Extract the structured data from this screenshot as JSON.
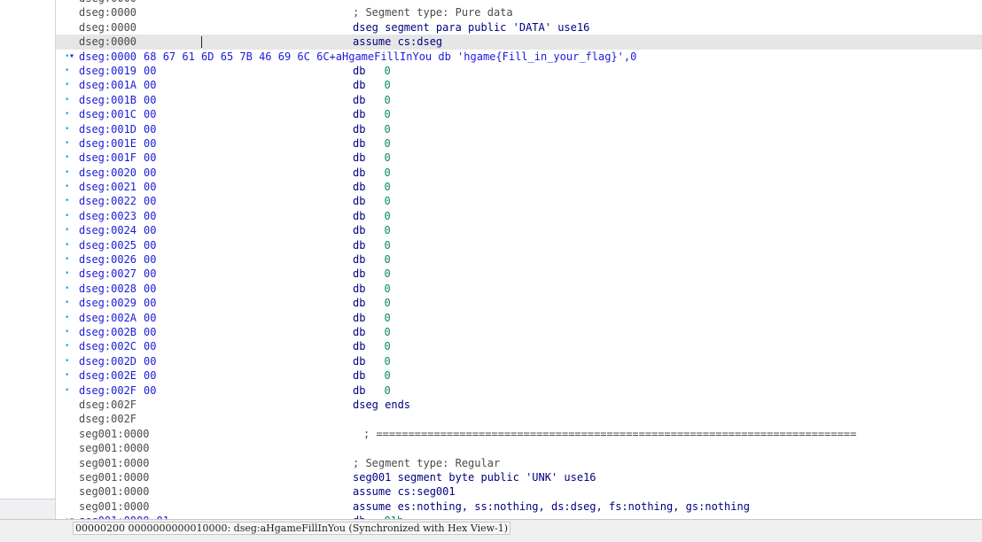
{
  "status_text": "00000200 0000000000010000: dseg:aHgameFillInYou (Synchronized with Hex View-1)",
  "colors": {
    "accent": "#1b1bd8",
    "comment": "#4a4a4a",
    "number": "#0b8a5d",
    "selected_bg": "#e6e6e6"
  },
  "listing": [
    {
      "addr": "dseg:0000",
      "bytes": "",
      "text": "",
      "kind": "partial"
    },
    {
      "addr": "dseg:0000",
      "bytes": "",
      "text": "; Segment type: Pure data",
      "kind": "comment"
    },
    {
      "addr": "dseg:0000",
      "bytes": "",
      "text": "dseg segment para public 'DATA' use16",
      "kind": "directive"
    },
    {
      "addr": "dseg:0000",
      "bytes": "",
      "text": "assume cs:dseg",
      "kind": "directive",
      "selected": true
    },
    {
      "addr": "dseg:0000",
      "bytes": "68 67 61 6D 65 7B 46 69 6C 6C+",
      "text": "aHgameFillInYou db 'hgame{Fill_in_your_flag}',0",
      "kind": "string",
      "dot": true
    },
    {
      "addr": "dseg:0019",
      "bytes": "00",
      "mnem": "db",
      "val": "0",
      "kind": "db",
      "dot": true
    },
    {
      "addr": "dseg:001A",
      "bytes": "00",
      "mnem": "db",
      "val": "0",
      "kind": "db",
      "dot": true
    },
    {
      "addr": "dseg:001B",
      "bytes": "00",
      "mnem": "db",
      "val": "0",
      "kind": "db",
      "dot": true
    },
    {
      "addr": "dseg:001C",
      "bytes": "00",
      "mnem": "db",
      "val": "0",
      "kind": "db",
      "dot": true
    },
    {
      "addr": "dseg:001D",
      "bytes": "00",
      "mnem": "db",
      "val": "0",
      "kind": "db",
      "dot": true
    },
    {
      "addr": "dseg:001E",
      "bytes": "00",
      "mnem": "db",
      "val": "0",
      "kind": "db",
      "dot": true
    },
    {
      "addr": "dseg:001F",
      "bytes": "00",
      "mnem": "db",
      "val": "0",
      "kind": "db",
      "dot": true
    },
    {
      "addr": "dseg:0020",
      "bytes": "00",
      "mnem": "db",
      "val": "0",
      "kind": "db",
      "dot": true
    },
    {
      "addr": "dseg:0021",
      "bytes": "00",
      "mnem": "db",
      "val": "0",
      "kind": "db",
      "dot": true
    },
    {
      "addr": "dseg:0022",
      "bytes": "00",
      "mnem": "db",
      "val": "0",
      "kind": "db",
      "dot": true
    },
    {
      "addr": "dseg:0023",
      "bytes": "00",
      "mnem": "db",
      "val": "0",
      "kind": "db",
      "dot": true
    },
    {
      "addr": "dseg:0024",
      "bytes": "00",
      "mnem": "db",
      "val": "0",
      "kind": "db",
      "dot": true
    },
    {
      "addr": "dseg:0025",
      "bytes": "00",
      "mnem": "db",
      "val": "0",
      "kind": "db",
      "dot": true
    },
    {
      "addr": "dseg:0026",
      "bytes": "00",
      "mnem": "db",
      "val": "0",
      "kind": "db",
      "dot": true
    },
    {
      "addr": "dseg:0027",
      "bytes": "00",
      "mnem": "db",
      "val": "0",
      "kind": "db",
      "dot": true
    },
    {
      "addr": "dseg:0028",
      "bytes": "00",
      "mnem": "db",
      "val": "0",
      "kind": "db",
      "dot": true
    },
    {
      "addr": "dseg:0029",
      "bytes": "00",
      "mnem": "db",
      "val": "0",
      "kind": "db",
      "dot": true
    },
    {
      "addr": "dseg:002A",
      "bytes": "00",
      "mnem": "db",
      "val": "0",
      "kind": "db",
      "dot": true
    },
    {
      "addr": "dseg:002B",
      "bytes": "00",
      "mnem": "db",
      "val": "0",
      "kind": "db",
      "dot": true
    },
    {
      "addr": "dseg:002C",
      "bytes": "00",
      "mnem": "db",
      "val": "0",
      "kind": "db",
      "dot": true
    },
    {
      "addr": "dseg:002D",
      "bytes": "00",
      "mnem": "db",
      "val": "0",
      "kind": "db",
      "dot": true
    },
    {
      "addr": "dseg:002E",
      "bytes": "00",
      "mnem": "db",
      "val": "0",
      "kind": "db",
      "dot": true
    },
    {
      "addr": "dseg:002F",
      "bytes": "00",
      "mnem": "db",
      "val": "0",
      "kind": "db",
      "dot": true
    },
    {
      "addr": "dseg:002F",
      "bytes": "",
      "text": "dseg ends",
      "kind": "directive"
    },
    {
      "addr": "dseg:002F",
      "bytes": "",
      "text": "",
      "kind": "blank"
    },
    {
      "addr": "seg001:0000",
      "bytes": "",
      "text": "; ===========================================================================",
      "kind": "comment",
      "indent": true
    },
    {
      "addr": "seg001:0000",
      "bytes": "",
      "text": "",
      "kind": "blank"
    },
    {
      "addr": "seg001:0000",
      "bytes": "",
      "text": "; Segment type: Regular",
      "kind": "comment"
    },
    {
      "addr": "seg001:0000",
      "bytes": "",
      "text": "seg001 segment byte public 'UNK' use16",
      "kind": "directive"
    },
    {
      "addr": "seg001:0000",
      "bytes": "",
      "text": "assume cs:seg001",
      "kind": "directive"
    },
    {
      "addr": "seg001:0000",
      "bytes": "",
      "text": "assume es:nothing, ss:nothing, ds:dseg, fs:nothing, gs:nothing",
      "kind": "directive"
    },
    {
      "addr": "seg001:0000",
      "bytes": "01",
      "mnem": "db",
      "val": "01h",
      "kind": "db",
      "dot": true,
      "arrow": true
    }
  ]
}
